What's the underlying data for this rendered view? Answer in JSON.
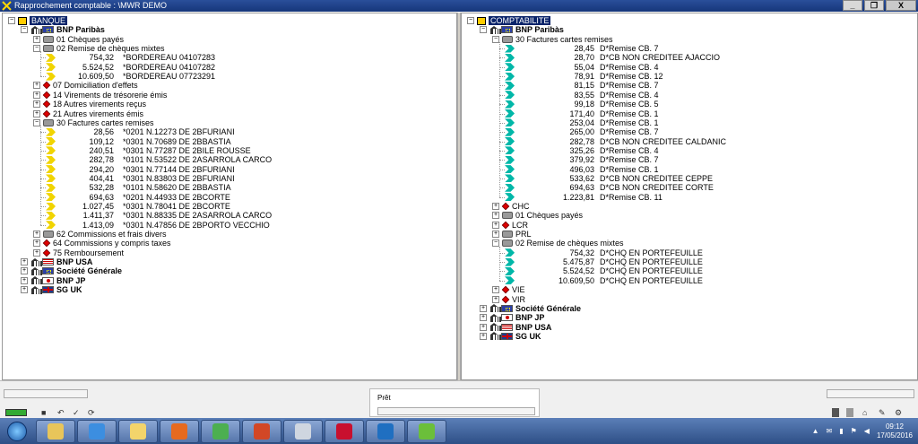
{
  "window": {
    "title": "Rapprochement comptable : \\MWR DEMO",
    "minimize": "_",
    "restore": "❐",
    "close": "X"
  },
  "left": {
    "root": "BANQUE",
    "banks": [
      {
        "name": "BNP Paribàs",
        "flag": "eu",
        "expanded": true,
        "children": [
          {
            "label": "01 Chèques payés",
            "icon": "checks-icon",
            "expanded": false
          },
          {
            "label": "02 Remise de chèques mixtes",
            "icon": "checks-icon",
            "expanded": true,
            "items": [
              {
                "amount": "754,32",
                "text": "*BORDEREAU 04107283"
              },
              {
                "amount": "5.524,52",
                "text": "*BORDEREAU 04107282"
              },
              {
                "amount": "10.609,50",
                "text": "*BORDEREAU 07723291"
              }
            ]
          },
          {
            "label": "07 Domiciliation d'effets",
            "icon": "gem-icon",
            "expanded": false
          },
          {
            "label": "14 Virements de trésorerie émis",
            "icon": "gem-icon",
            "expanded": false
          },
          {
            "label": "18 Autres virements reçus",
            "icon": "gem-icon",
            "expanded": false
          },
          {
            "label": "21 Autres virements émis",
            "icon": "gem-icon",
            "expanded": false
          },
          {
            "label": "30 Factures cartes remises",
            "icon": "checks-icon",
            "expanded": true,
            "items": [
              {
                "amount": "28,56",
                "text": "*0201 N.12273 DE 2BFURIANI"
              },
              {
                "amount": "109,12",
                "text": "*0301 N.70689 DE 2BBASTIA"
              },
              {
                "amount": "240,51",
                "text": "*0301 N.77287 DE 2BILE ROUSSE"
              },
              {
                "amount": "282,78",
                "text": "*0101 N.53522 DE 2ASARROLA CARCO"
              },
              {
                "amount": "294,20",
                "text": "*0301 N.77144 DE 2BFURIANI"
              },
              {
                "amount": "404,41",
                "text": "*0301 N.83803 DE 2BFURIANI"
              },
              {
                "amount": "532,28",
                "text": "*0101 N.58620 DE 2BBASTIA"
              },
              {
                "amount": "694,63",
                "text": "*0201 N.44933 DE 2BCORTE"
              },
              {
                "amount": "1.027,45",
                "text": "*0301 N.78041 DE 2BCORTE"
              },
              {
                "amount": "1.411,37",
                "text": "*0301 N.88335 DE 2ASARROLA CARCO"
              },
              {
                "amount": "1.413,09",
                "text": "*0301 N.47856 DE 2BPORTO VECCHIO"
              }
            ]
          },
          {
            "label": "62 Commissions et frais divers",
            "icon": "checks-icon",
            "expanded": false
          },
          {
            "label": "64 Commissions y compris taxes",
            "icon": "gem-icon",
            "expanded": false
          },
          {
            "label": "75 Remboursement",
            "icon": "gem-icon",
            "expanded": false
          }
        ]
      },
      {
        "name": "BNP USA",
        "flag": "us",
        "expanded": false
      },
      {
        "name": "Société Générale",
        "flag": "eu",
        "expanded": false
      },
      {
        "name": "BNP JP",
        "flag": "jp",
        "expanded": false
      },
      {
        "name": "SG UK",
        "flag": "uk",
        "expanded": false
      }
    ]
  },
  "right": {
    "root": "COMPTABILITE",
    "banks": [
      {
        "name": "BNP Paribàs",
        "flag": "eu",
        "expanded": true,
        "children": [
          {
            "label": "30 Factures cartes remises",
            "icon": "checks-icon",
            "expanded": true,
            "items": [
              {
                "amount": "28,45",
                "text": "D*Remise CB.  7"
              },
              {
                "amount": "28,70",
                "text": "D*CB NON CREDITEE AJACCIO"
              },
              {
                "amount": "55,04",
                "text": "D*Remise CB.  4"
              },
              {
                "amount": "78,91",
                "text": "D*Remise CB.  12"
              },
              {
                "amount": "81,15",
                "text": "D*Remise CB.  7"
              },
              {
                "amount": "83,55",
                "text": "D*Remise CB.  4"
              },
              {
                "amount": "99,18",
                "text": "D*Remise CB.  5"
              },
              {
                "amount": "171,40",
                "text": "D*Remise CB.  1"
              },
              {
                "amount": "253,04",
                "text": "D*Remise CB.  1"
              },
              {
                "amount": "265,00",
                "text": "D*Remise CB.  7"
              },
              {
                "amount": "282,78",
                "text": "D*CB NON CREDITEE CALDANIC"
              },
              {
                "amount": "325,26",
                "text": "D*Remise CB.  4"
              },
              {
                "amount": "379,92",
                "text": "D*Remise CB.  7"
              },
              {
                "amount": "496,03",
                "text": "D*Remise CB.  1"
              },
              {
                "amount": "533,62",
                "text": "D*CB NON CREDITEE CEPPE"
              },
              {
                "amount": "694,63",
                "text": "D*CB NON CREDITEE CORTE"
              },
              {
                "amount": "1.223,81",
                "text": "D*Remise CB.  11"
              }
            ]
          },
          {
            "label": "CHC",
            "icon": "gem-icon",
            "expanded": false
          },
          {
            "label": "01 Chèques payés",
            "icon": "checks-icon",
            "expanded": false
          },
          {
            "label": "LCR",
            "icon": "gem-icon",
            "expanded": false
          },
          {
            "label": "PRL",
            "icon": "checks-icon",
            "expanded": false
          },
          {
            "label": "02 Remise de chèques mixtes",
            "icon": "checks-icon",
            "expanded": true,
            "items": [
              {
                "amount": "754,32",
                "text": "D*CHQ EN PORTEFEUILLE"
              },
              {
                "amount": "5.475,87",
                "text": "D*CHQ EN PORTEFEUILLE"
              },
              {
                "amount": "5.524,52",
                "text": "D*CHQ EN PORTEFEUILLE"
              },
              {
                "amount": "10.609,50",
                "text": "D*CHQ EN PORTEFEUILLE"
              }
            ]
          },
          {
            "label": "VIE",
            "icon": "gem-icon",
            "expanded": false
          },
          {
            "label": "VIR",
            "icon": "gem-icon",
            "expanded": false
          }
        ]
      },
      {
        "name": "Société Générale",
        "flag": "eu",
        "expanded": false
      },
      {
        "name": "BNP JP",
        "flag": "jp",
        "expanded": false
      },
      {
        "name": "BNP USA",
        "flag": "us",
        "expanded": false
      },
      {
        "name": "SG UK",
        "flag": "uk",
        "expanded": false
      }
    ]
  },
  "status": {
    "text": "Prêt"
  },
  "taskbar": {
    "apps": [
      {
        "name": "explorer",
        "color": "#e8c55a"
      },
      {
        "name": "internet-explorer",
        "color": "#3c8ee0"
      },
      {
        "name": "folder",
        "color": "#f3d46b"
      },
      {
        "name": "firefox",
        "color": "#e66a1f"
      },
      {
        "name": "chrome",
        "color": "#4caf50"
      },
      {
        "name": "powerpoint",
        "color": "#d24726"
      },
      {
        "name": "calculator",
        "color": "#cfd6e0"
      },
      {
        "name": "acrobat",
        "color": "#c8102e"
      },
      {
        "name": "outlook",
        "color": "#1f6fc1"
      },
      {
        "name": "rapprochement",
        "color": "#6bbf3a"
      }
    ],
    "time": "09:12",
    "date": "17/05/2016"
  }
}
